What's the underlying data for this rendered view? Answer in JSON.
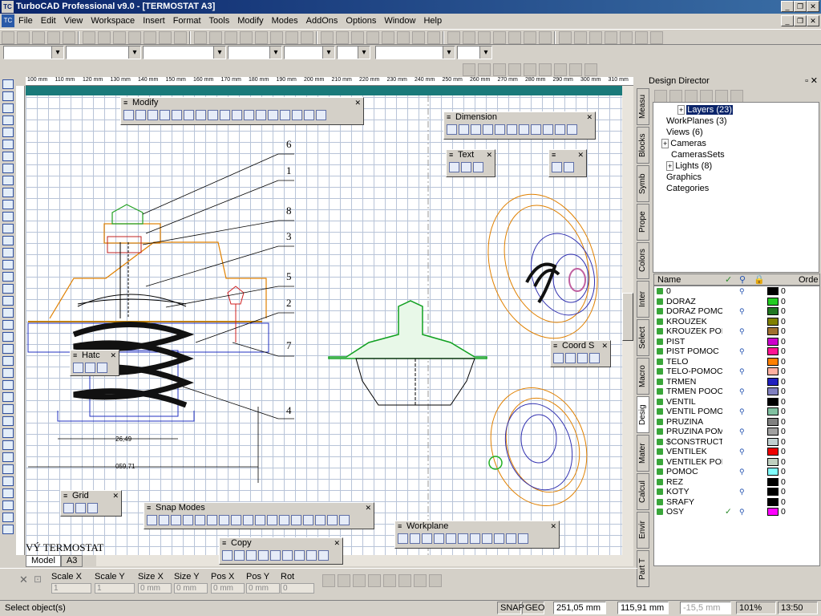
{
  "window": {
    "title": "TurboCAD Professional v9.0 - [TERMOSTAT A3]",
    "app_icon": "TC"
  },
  "menu": [
    "File",
    "Edit",
    "View",
    "Workspace",
    "Insert",
    "Format",
    "Tools",
    "Modify",
    "Modes",
    "AddOns",
    "Options",
    "Window",
    "Help"
  ],
  "ruler_labels": [
    "100 mm",
    "110 mm",
    "120 mm",
    "130 mm",
    "140 mm",
    "150 mm",
    "160 mm",
    "170 mm",
    "180 mm",
    "190 mm",
    "200 mm",
    "210 mm",
    "220 mm",
    "230 mm",
    "240 mm",
    "250 mm",
    "260 mm",
    "270 mm",
    "280 mm",
    "290 mm",
    "300 mm",
    "310 mm"
  ],
  "palettes": {
    "modify": "Modify",
    "dimension": "Dimension",
    "text": "Text",
    "hatch": "Hatc",
    "coord": "Coord S",
    "grid": "Grid",
    "snap": "Snap Modes",
    "copy": "Copy",
    "workplane": "Workplane"
  },
  "drawing": {
    "callouts": [
      "6",
      "1",
      "8",
      "3",
      "5",
      "2",
      "7",
      "4"
    ],
    "dim_inner": "26,49",
    "dim_outer": "059,71",
    "title_text": "VÝ  TERMOSTAT"
  },
  "sheet_tabs": [
    "Model",
    "A3"
  ],
  "design_director": {
    "title": "Design Director",
    "side_tabs": [
      "Measu",
      "Blocks",
      "Symb",
      "Prope",
      "Colors",
      "Inter",
      "Select",
      "Macro",
      "Desig",
      "Mater",
      "Calcul",
      "Envir",
      "Part T"
    ],
    "tree": [
      {
        "label": "Layers (23)",
        "selected": true
      },
      {
        "label": "WorkPlanes (3)"
      },
      {
        "label": "Views (6)"
      },
      {
        "label": "Cameras"
      },
      {
        "label": "CamerasSets"
      },
      {
        "label": "Lights (8)"
      },
      {
        "label": "Graphics"
      },
      {
        "label": "Categories"
      }
    ],
    "layer_table_header": {
      "name": "Name",
      "order": "Orde"
    },
    "layers": [
      {
        "name": "0",
        "color": "#000000",
        "order": "0",
        "check": false
      },
      {
        "name": "DORAZ",
        "color": "#22cc22",
        "order": "0",
        "check": false
      },
      {
        "name": "DORAZ POMO",
        "color": "#227722",
        "order": "0",
        "check": false
      },
      {
        "name": "KROUZEK",
        "color": "#808000",
        "order": "0",
        "check": false
      },
      {
        "name": "KROUZEK POM",
        "color": "#a07030",
        "order": "0",
        "check": false
      },
      {
        "name": "PIST",
        "color": "#cc00cc",
        "order": "0",
        "check": false
      },
      {
        "name": "PIST POMOC",
        "color": "#ff1493",
        "order": "0",
        "check": false
      },
      {
        "name": "TELO",
        "color": "#ff8000",
        "order": "0",
        "check": false
      },
      {
        "name": "TELO-POMOC",
        "color": "#ffb0a0",
        "order": "0",
        "check": false
      },
      {
        "name": "TRMEN",
        "color": "#2020c0",
        "order": "0",
        "check": false
      },
      {
        "name": "TRMEN POOC",
        "color": "#8080c0",
        "order": "0",
        "check": false
      },
      {
        "name": "VENTIL",
        "color": "#000000",
        "order": "0",
        "check": false
      },
      {
        "name": "VENTIL POMO",
        "color": "#80c0a0",
        "order": "0",
        "check": false
      },
      {
        "name": "PRUZINA",
        "color": "#808080",
        "order": "0",
        "check": false
      },
      {
        "name": "PRUZINA POM",
        "color": "#a0a0a0",
        "order": "0",
        "check": false
      },
      {
        "name": "$CONSTRUCT",
        "color": "#c0d0d0",
        "order": "0",
        "check": false
      },
      {
        "name": "VENTILEK",
        "color": "#ee0000",
        "order": "0",
        "check": false
      },
      {
        "name": "VENTILEK POM",
        "color": "#c0d0c0",
        "order": "0",
        "check": false
      },
      {
        "name": "POMOC",
        "color": "#80ffff",
        "order": "0",
        "check": false
      },
      {
        "name": "REZ",
        "color": "#000000",
        "order": "0",
        "check": false
      },
      {
        "name": "KOTY",
        "color": "#000000",
        "order": "0",
        "check": false
      },
      {
        "name": "SRAFY",
        "color": "#000000",
        "order": "0",
        "check": false
      },
      {
        "name": "OSY",
        "color": "#ff00ff",
        "order": "0",
        "check": true
      }
    ]
  },
  "properties": {
    "labels": [
      "Scale X",
      "Scale Y",
      "Size X",
      "Size Y",
      "Pos X",
      "Pos Y",
      "Rot"
    ],
    "values": [
      "1",
      "1",
      "0 mm",
      "0 mm",
      "0 mm",
      "0 mm",
      "0"
    ]
  },
  "status": {
    "message": "Select object(s)",
    "snap": "SNAP",
    "geo": "GEO",
    "x": "251,05 mm",
    "y": "115,91 mm",
    "z": "-15,5 mm",
    "zoom": "101%",
    "time": "13:50"
  }
}
